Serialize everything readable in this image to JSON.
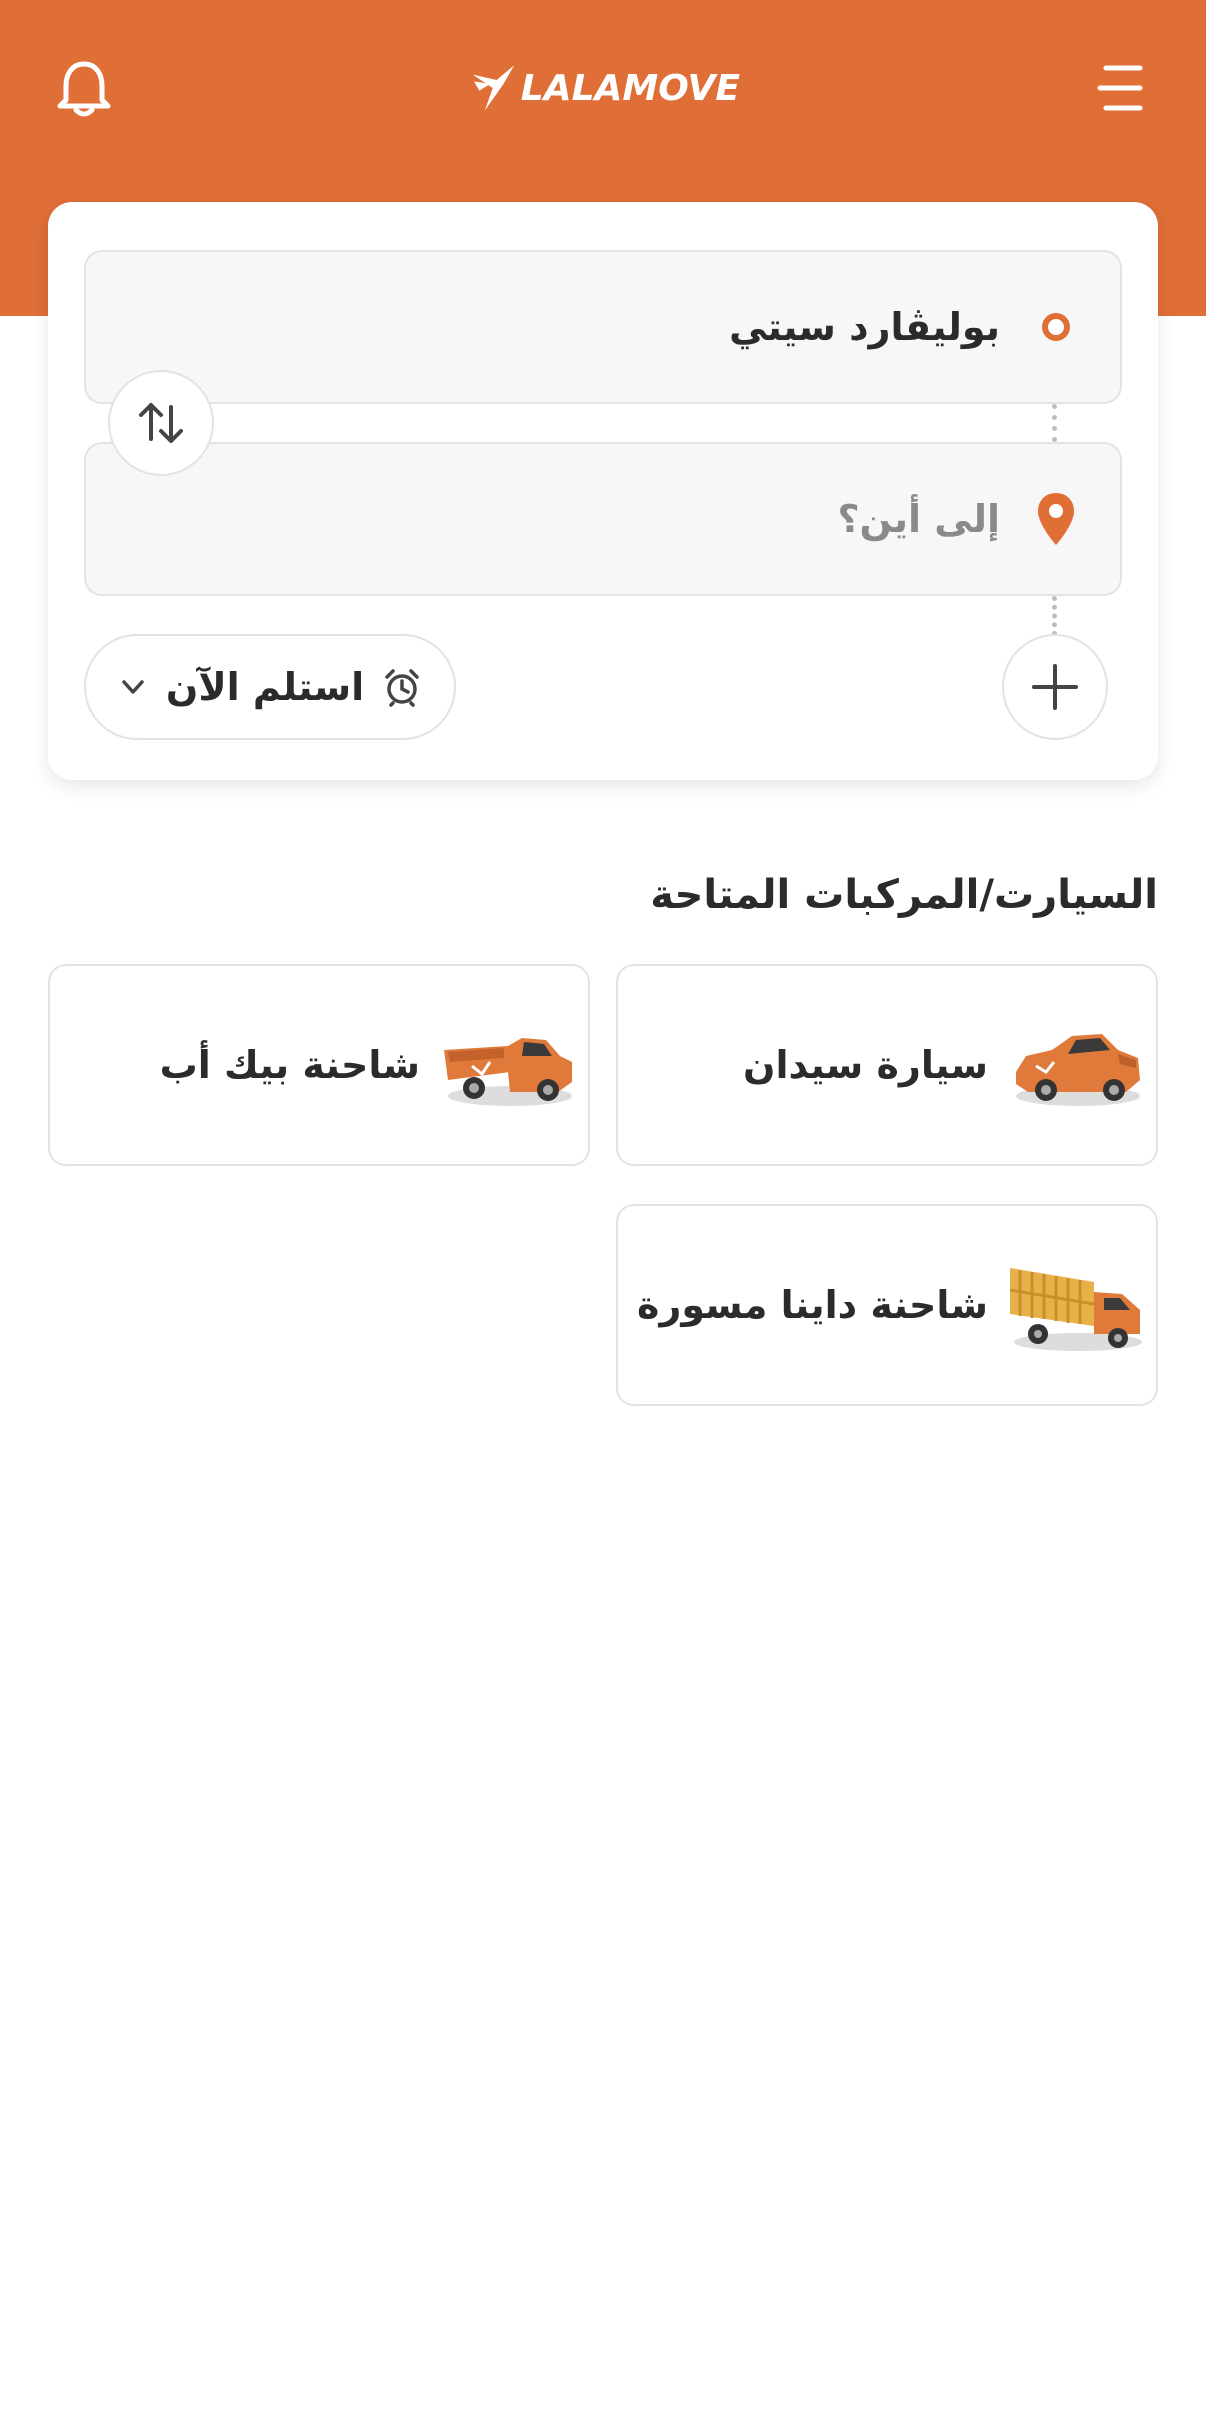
{
  "header": {
    "brand": "LALAMOVE",
    "bg_color": "#E06E37",
    "left_icon": "bell-icon",
    "right_icon": "hamburger-menu-icon"
  },
  "route": {
    "pickup": "بوليڤارد سيتي",
    "dropoff_placeholder": "إلى أين؟",
    "swap_icon": "swap-arrows-icon",
    "pickup_marker": "pickup-circle-icon",
    "dropoff_marker": "location-pin-icon"
  },
  "schedule": {
    "label": "استلم الآن",
    "icon": "alarm-clock-icon",
    "dropdown_icon": "chevron-down-icon"
  },
  "add_stop_icon": "plus-icon",
  "vehicles": {
    "title": "السيارت/المركبات المتاحة",
    "items": [
      {
        "name": "سيارة سيدان",
        "icon": "sedan-car-icon"
      },
      {
        "name": "شاحنة بيك أب",
        "icon": "pickup-truck-icon"
      },
      {
        "name": "شاحنة داينا مسورة",
        "icon": "dyna-cage-truck-icon"
      }
    ]
  }
}
